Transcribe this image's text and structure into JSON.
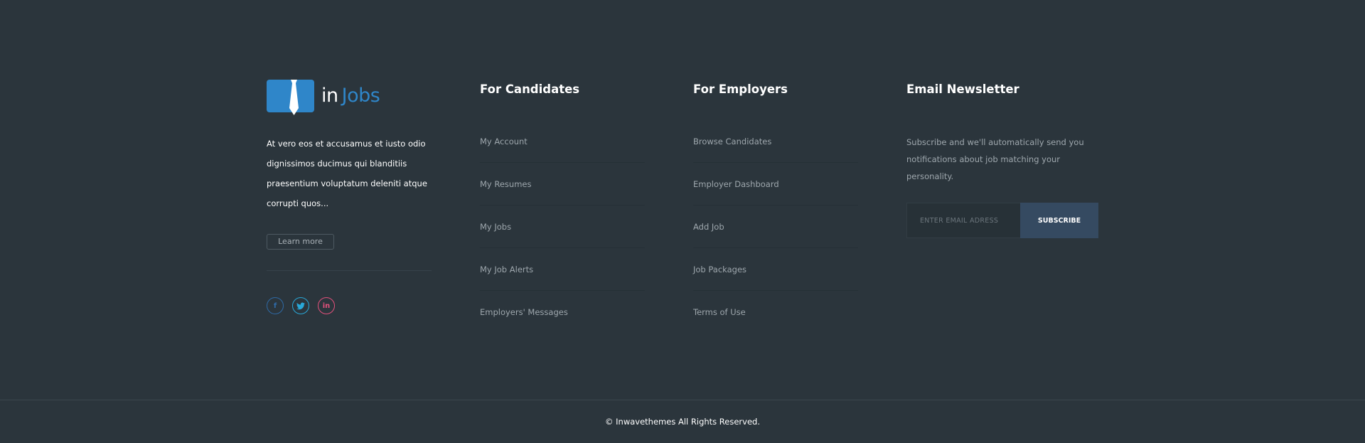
{
  "brand": {
    "logo_prefix": "in",
    "logo_name": "Jobs",
    "primary_color": "#2f86c9",
    "logo_icon": "tie-icon"
  },
  "about": {
    "text": "At vero eos et accusamus et iusto odio dignissimos ducimus qui blanditiis praesentium voluptatum deleniti atque corrupti quos...",
    "learn_more_label": "Learn more",
    "social": [
      {
        "name": "facebook",
        "glyph": "f",
        "color": "#2f6aa6"
      },
      {
        "name": "twitter",
        "glyph": "t",
        "color": "#29a8d8"
      },
      {
        "name": "linkedin",
        "glyph": "in",
        "color": "#e4517c"
      }
    ]
  },
  "candidates": {
    "title": "For Candidates",
    "links": [
      "My Account",
      "My Resumes",
      "My Jobs",
      "My Job Alerts",
      "Employers' Messages"
    ]
  },
  "employers": {
    "title": "For Employers",
    "links": [
      "Browse Candidates",
      "Employer Dashboard",
      "Add Job",
      "Job Packages",
      "Terms of Use"
    ]
  },
  "newsletter": {
    "title": "Email Newsletter",
    "text": "Subscribe and we'll automatically send you notifications about job matching your personality.",
    "input_placeholder": "ENTER EMAIL ADRESS",
    "button_label": "SUBSCRIBE",
    "button_color": "#354a61"
  },
  "copyright": "© Inwavethemes All Rights Reserved."
}
